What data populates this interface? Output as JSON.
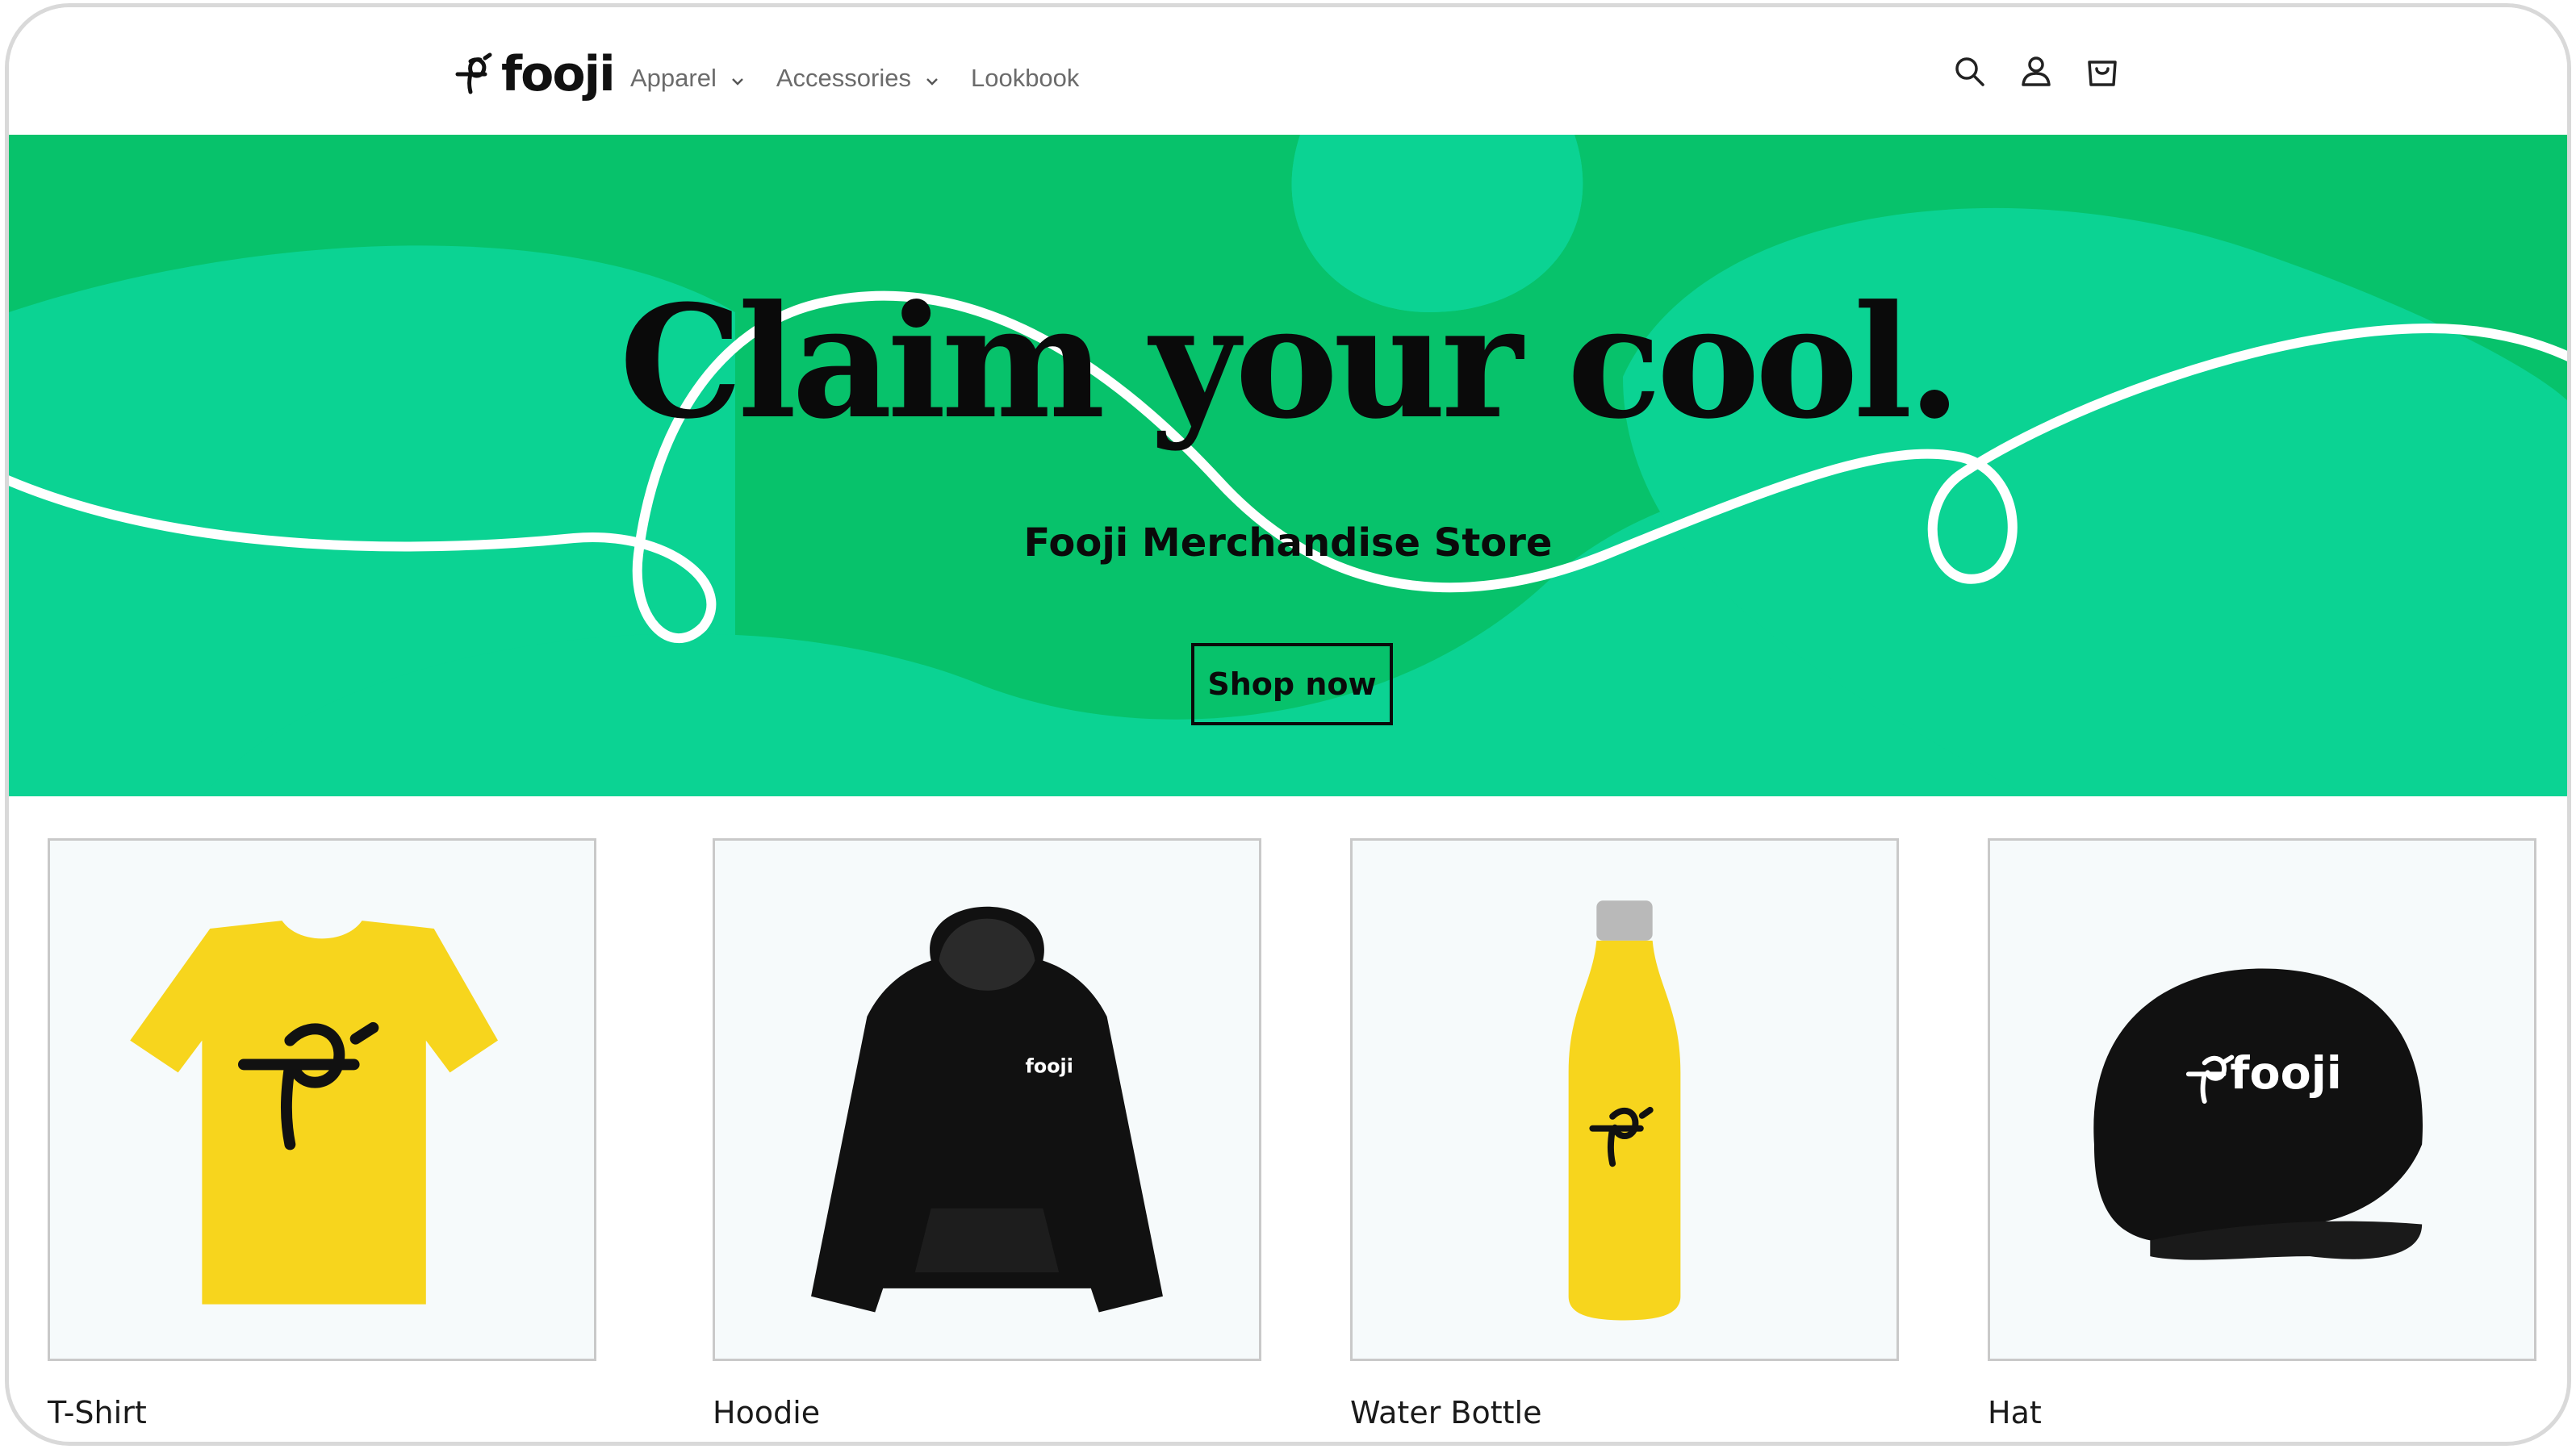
{
  "header": {
    "logo_text": "fooji",
    "nav": [
      {
        "label": "Apparel",
        "has_dropdown": true
      },
      {
        "label": "Accessories",
        "has_dropdown": true
      },
      {
        "label": "Lookbook",
        "has_dropdown": false
      }
    ],
    "icons": [
      "search-icon",
      "account-icon",
      "cart-icon"
    ]
  },
  "hero": {
    "title": "Claim your cool.",
    "subtitle": "Fooji Merchandise Store",
    "cta_label": "Shop now",
    "colors": {
      "background": "#0bd393",
      "blob": "#07c26b",
      "swirl": "#ffffff"
    }
  },
  "products": [
    {
      "title": "T-Shirt",
      "color": "#f7d51d"
    },
    {
      "title": "Hoodie",
      "color": "#111111"
    },
    {
      "title": "Water Bottle",
      "color": "#f7d51d"
    },
    {
      "title": "Hat",
      "color": "#111111"
    }
  ],
  "product_logos": {
    "hoodie": "fooji",
    "hat": "fooji"
  }
}
